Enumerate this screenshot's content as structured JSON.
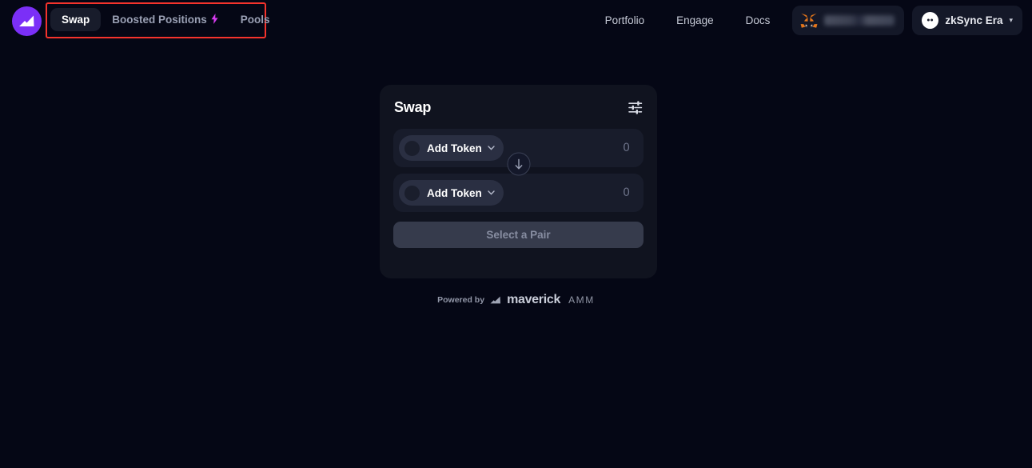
{
  "header": {
    "brand_logo_icon": "maverick-logo-icon",
    "tabs": [
      {
        "label": "Swap",
        "active": true,
        "icon": ""
      },
      {
        "label": "Boosted Positions",
        "active": false,
        "icon": "lightning-bolt-icon",
        "bolt": "⚡"
      },
      {
        "label": "Pools",
        "active": false,
        "icon": ""
      }
    ],
    "links": [
      {
        "label": "Portfolio"
      },
      {
        "label": "Engage"
      },
      {
        "label": "Docs"
      }
    ],
    "wallet": {
      "icon": "metamask-fox-icon",
      "address": ""
    },
    "network": {
      "icon": "zksync-icon",
      "label": "zkSync Era",
      "chevron": "▾"
    }
  },
  "swap_card": {
    "title": "Swap",
    "settings_icon": "sliders-icon",
    "rows": [
      {
        "token_label": "Add Token",
        "chevron": "⌄",
        "amount": "0",
        "token_icon": "token-placeholder-icon"
      },
      {
        "token_label": "Add Token",
        "chevron": "⌄",
        "amount": "0",
        "token_icon": "token-placeholder-icon"
      }
    ],
    "swap_direction_icon": "arrow-down-icon",
    "cta_label": "Select a Pair"
  },
  "footer": {
    "powered_by": "Powered by",
    "logo_icon": "maverick-bars-icon",
    "brand": "maverick",
    "product": "AMM"
  },
  "colors": {
    "background": "#050715",
    "card": "#10131f",
    "row": "#181c2b",
    "accent_purple": "#7b2ff7",
    "bolt_magenta": "#d63bf0",
    "highlight_red": "#f5332c",
    "cta_bg": "#363b4c",
    "cta_text": "#878da1"
  }
}
